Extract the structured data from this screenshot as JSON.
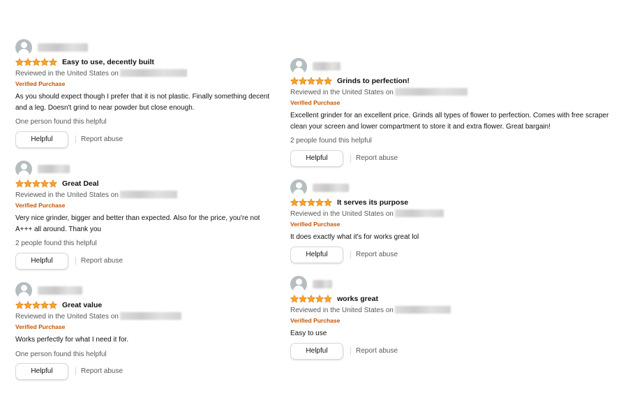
{
  "accent_color": "#f5a623",
  "verified_color": "#c45500",
  "left_column": [
    {
      "title": "Easy to use, decently built",
      "reviewed_in": "Reviewed in the United States on",
      "verified": "Verified Purchase",
      "body_lines": [
        "As you should expect though I prefer that it is not plastic. Finally something decent",
        "and a leg. Doesn't grind to near powder but close enough."
      ],
      "helpful_count": "One person found this helpful",
      "helpful_label": "Helpful",
      "report_label": "Report abuse"
    },
    {
      "title": "Great Deal",
      "reviewed_in": "Reviewed in the United States on",
      "verified": "Verified Purchase",
      "body_lines": [
        "Very nice grinder, bigger and better than expected. Also for the price, you're not",
        "A+++ all around. Thank you"
      ],
      "helpful_count": "2 people found this helpful",
      "helpful_label": "Helpful",
      "report_label": "Report abuse"
    },
    {
      "title": "Great value",
      "reviewed_in": "Reviewed in the United States on",
      "verified": "Verified Purchase",
      "body_lines": [
        "Works perfectly for what I need it for."
      ],
      "helpful_count": "One person found this helpful",
      "helpful_label": "Helpful",
      "report_label": "Report abuse"
    }
  ],
  "right_column": [
    {
      "title": "Grinds to perfection!",
      "reviewed_in": "Reviewed in the United States on",
      "verified": "Verified Purchase",
      "body_lines": [
        "Excellent grinder for an excellent price. Grinds all types of flower to perfection. Comes with free scraper",
        "clean your screen and lower compartment to store it and extra flower. Great bargain!"
      ],
      "helpful_count": "2 people found this helpful",
      "helpful_label": "Helpful",
      "report_label": "Report abuse"
    },
    {
      "title": "It serves its purpose",
      "reviewed_in": "Reviewed in the United States on",
      "verified": "Verified Purchase",
      "body_lines": [
        "It does exactly what it's for works great lol"
      ],
      "helpful_label": "Helpful",
      "report_label": "Report abuse"
    },
    {
      "title": "works great",
      "reviewed_in": "Reviewed in the United States on",
      "verified": "Verified Purchase",
      "body_lines": [
        "Easy to use"
      ],
      "helpful_label": "Helpful",
      "report_label": "Report abuse"
    }
  ]
}
